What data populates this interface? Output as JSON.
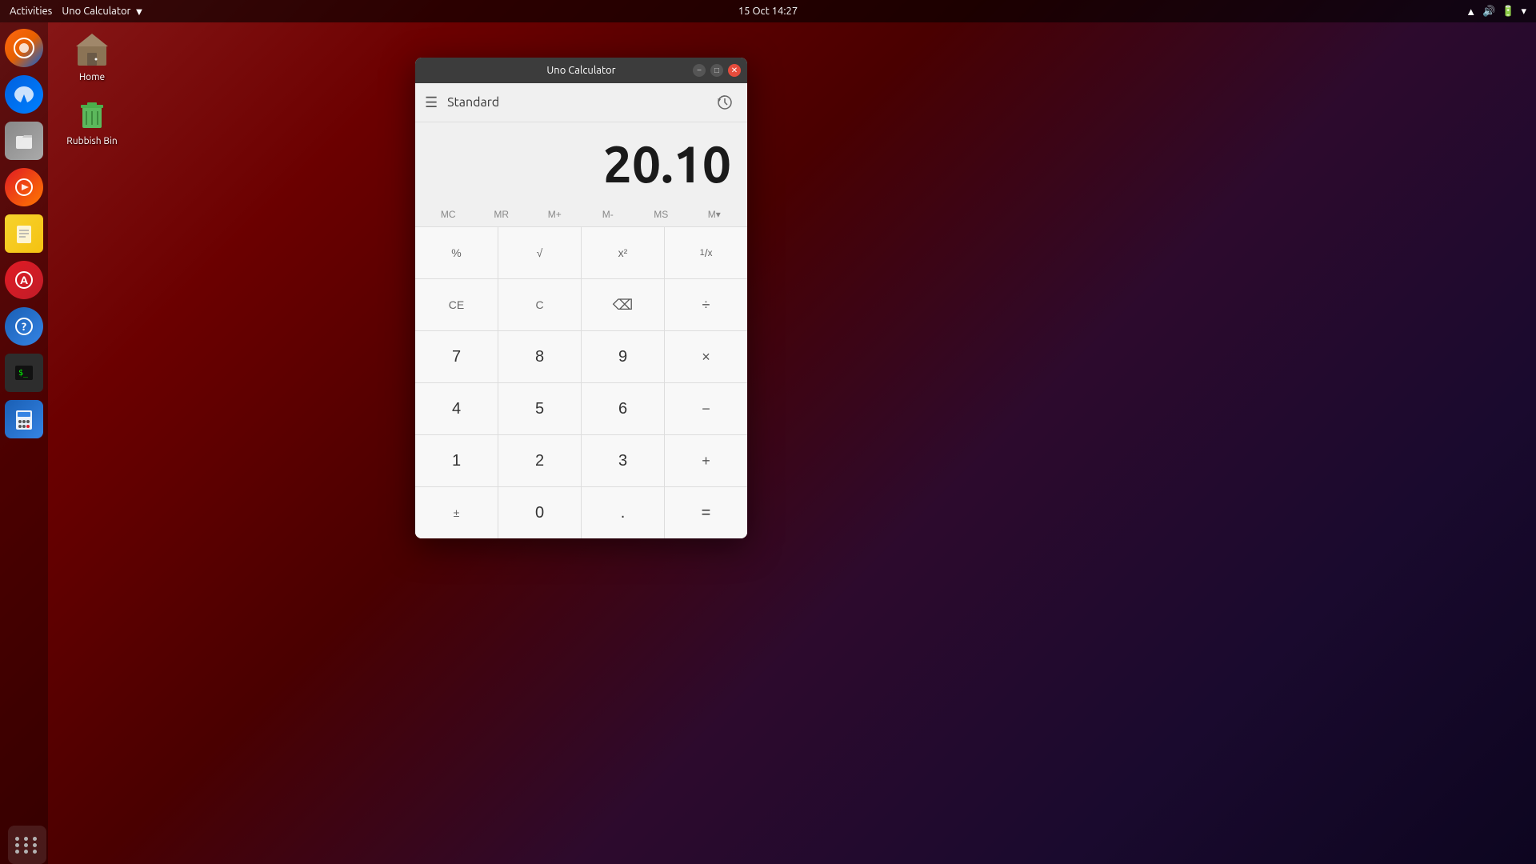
{
  "topbar": {
    "activities": "Activities",
    "app_name": "Uno Calculator",
    "app_dropdown": "▼",
    "datetime": "15 Oct  14:27",
    "system_icons": [
      "wifi",
      "volume",
      "battery",
      "settings"
    ]
  },
  "desktop": {
    "icons": [
      {
        "id": "home",
        "label": "Home"
      },
      {
        "id": "rubbish-bin",
        "label": "Rubbish Bin"
      }
    ]
  },
  "calculator": {
    "title": "Uno Calculator",
    "mode": "Standard",
    "display": "20.10",
    "memory_buttons": [
      "MC",
      "MR",
      "M+",
      "M-",
      "MS",
      "M▾"
    ],
    "buttons": [
      [
        "%",
        "√",
        "x²",
        "¹/x"
      ],
      [
        "CE",
        "C",
        "⌫",
        "÷"
      ],
      [
        "7",
        "8",
        "9",
        "×"
      ],
      [
        "4",
        "5",
        "6",
        "−"
      ],
      [
        "1",
        "2",
        "3",
        "+"
      ],
      [
        "±",
        "0",
        ".",
        "="
      ]
    ]
  },
  "dock": {
    "items": [
      {
        "id": "firefox",
        "label": "",
        "icon": "firefox"
      },
      {
        "id": "thunderbird",
        "label": "",
        "icon": "thunderbird"
      },
      {
        "id": "files",
        "label": "",
        "icon": "files"
      },
      {
        "id": "rhythmbox",
        "label": "",
        "icon": "rhythmbox"
      },
      {
        "id": "notes",
        "label": "",
        "icon": "notes"
      },
      {
        "id": "software",
        "label": "",
        "icon": "software"
      },
      {
        "id": "help",
        "label": "",
        "icon": "help"
      },
      {
        "id": "terminal",
        "label": "",
        "icon": "terminal"
      },
      {
        "id": "calc",
        "label": "",
        "icon": "calc"
      }
    ]
  }
}
